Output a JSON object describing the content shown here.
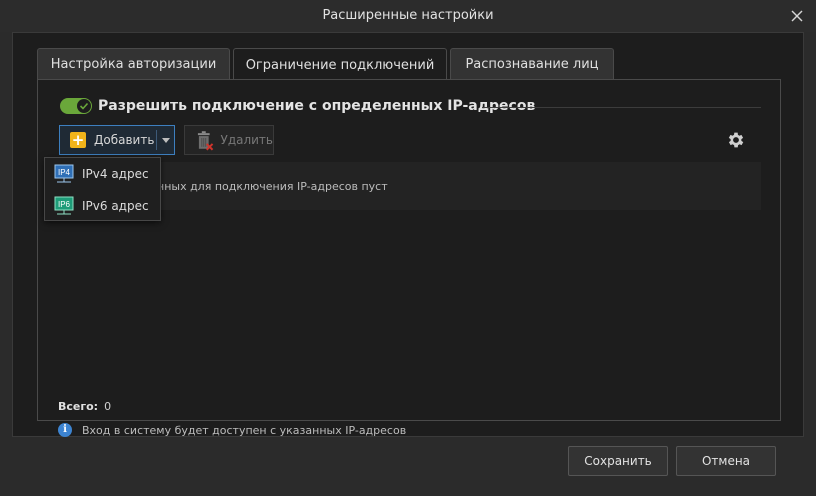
{
  "window": {
    "title": "Расширенные настройки"
  },
  "tabs": [
    {
      "label": "Настройка авторизации"
    },
    {
      "label": "Ограничение подключений"
    },
    {
      "label": "Распознавание лиц"
    }
  ],
  "active_tab": "Ограничение подключений",
  "toggle": {
    "label": "Разрешить подключение с определенных IP-адресов",
    "state": "on",
    "color": "#6aa73a"
  },
  "toolbar": {
    "add_label": "Добавить",
    "delete_label": "Удалить"
  },
  "dropdown": {
    "items": [
      {
        "label": "IPv4 адрес",
        "icon": "ipv4-icon",
        "icon_text": "IP4"
      },
      {
        "label": "IPv6 адрес",
        "icon": "ipv6-icon",
        "icon_text": "IP6"
      }
    ]
  },
  "list": {
    "empty_text": "нных для подключения IP-адресов пуст"
  },
  "summary": {
    "total_label": "Всего:",
    "total_value": "0"
  },
  "info": {
    "text": "Вход в систему будет доступен с указанных IP-адресов"
  },
  "footer": {
    "save_label": "Сохранить",
    "cancel_label": "Отмена"
  },
  "colors": {
    "accent": "#3d7fbf",
    "add_icon": "#f2b41a",
    "info": "#3d84d1"
  }
}
